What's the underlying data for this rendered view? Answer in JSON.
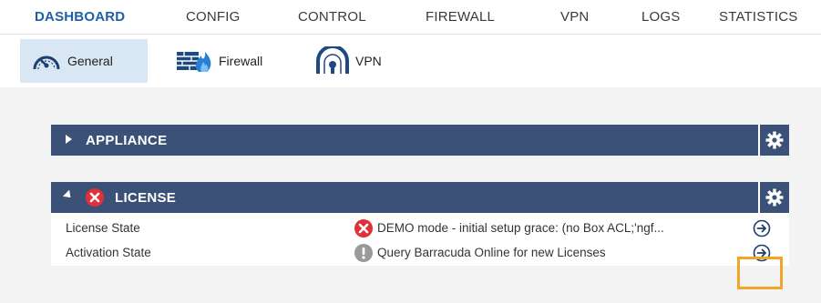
{
  "topnav": {
    "tabs": [
      {
        "label": "DASHBOARD",
        "active": true
      },
      {
        "label": "CONFIG"
      },
      {
        "label": "CONTROL"
      },
      {
        "label": "FIREWALL"
      },
      {
        "label": "VPN"
      },
      {
        "label": "LOGS"
      },
      {
        "label": "STATISTICS"
      }
    ]
  },
  "subnav": {
    "tabs": [
      {
        "label": "General",
        "icon": "speedometer-icon",
        "active": true
      },
      {
        "label": "Firewall",
        "icon": "firewall-icon"
      },
      {
        "label": "VPN",
        "icon": "vpn-icon"
      }
    ]
  },
  "panels": {
    "appliance": {
      "title": "APPLIANCE",
      "collapsed": true
    },
    "license": {
      "title": "LICENSE",
      "status": "error",
      "rows": [
        {
          "label": "License State",
          "status_icon": "error-icon",
          "value": "DEMO mode - initial setup grace: (no Box ACL;'ngf..."
        },
        {
          "label": "Activation State",
          "status_icon": "info-icon",
          "value": "Query Barracuda Online for new Licenses"
        }
      ]
    }
  },
  "colors": {
    "accent": "#1f5fa8",
    "panel_header": "#3c5178",
    "active_subtab": "#d9e7f4",
    "error": "#e0303a",
    "highlight": "#f4a428"
  }
}
